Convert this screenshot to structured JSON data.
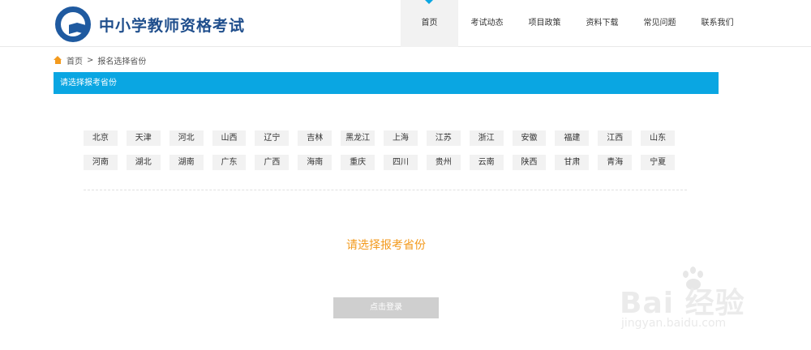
{
  "header": {
    "site_title": "中小学教师资格考试",
    "nav": [
      {
        "label": "首页",
        "active": true
      },
      {
        "label": "考试动态",
        "active": false
      },
      {
        "label": "项目政策",
        "active": false
      },
      {
        "label": "资料下载",
        "active": false
      },
      {
        "label": "常见问题",
        "active": false
      },
      {
        "label": "联系我们",
        "active": false
      }
    ]
  },
  "breadcrumb": {
    "home": "首页",
    "separator": ">",
    "current": "报名选择省份"
  },
  "section_bar": {
    "title": "请选择报考省份"
  },
  "provinces": {
    "row1": [
      "北京",
      "天津",
      "河北",
      "山西",
      "辽宁",
      "吉林",
      "黑龙江",
      "上海",
      "江苏",
      "浙江",
      "安徽",
      "福建",
      "江西",
      "山东"
    ],
    "row2": [
      "河南",
      "湖北",
      "湖南",
      "广东",
      "广西",
      "海南",
      "重庆",
      "四川",
      "贵州",
      "云南",
      "陕西",
      "甘肃",
      "青海",
      "宁夏"
    ]
  },
  "prompt": "请选择报考省份",
  "login_button": "点击登录",
  "watermark": {
    "brand": "Bai  经验",
    "url": "jingyan.baidu.com"
  },
  "colors": {
    "accent": "#0aa6e2",
    "prompt": "#f39a1d",
    "title": "#1f4e8c",
    "button_disabled": "#cfcfcf"
  }
}
